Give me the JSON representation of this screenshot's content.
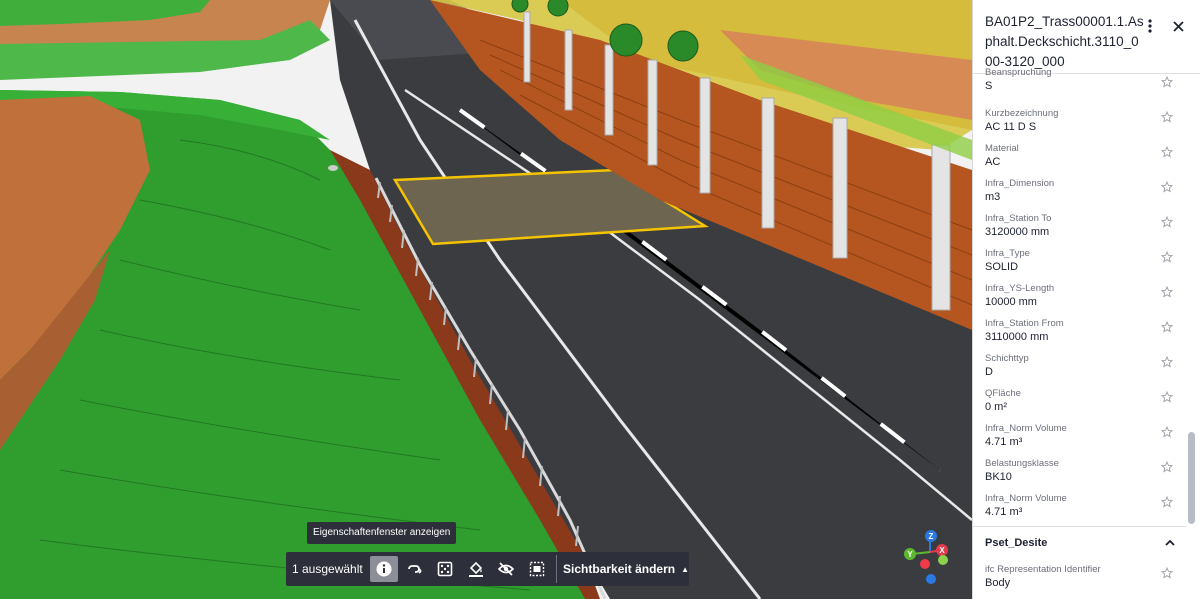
{
  "viewer": {
    "tooltip": "Eigenschaftenfenster anzeigen",
    "toolbar": {
      "selection_count": "1 ausgewählt",
      "visibility_label": "Sichtbarkeit ändern",
      "tools": [
        "info-icon",
        "link-icon",
        "dice-icon",
        "paint-bucket-icon",
        "eye-off-icon",
        "view-fit-icon"
      ]
    },
    "gizmo": {
      "z": "Z",
      "y": "Y",
      "x": "X"
    }
  },
  "panel": {
    "title": "BA01P2_Trass00001.1.Asphalt.Deckschicht.3110_000-3120_000",
    "properties": [
      {
        "name": "Beanspruchung",
        "value": "S"
      },
      {
        "name": "Kurzbezeichnung",
        "value": "AC 11 D S"
      },
      {
        "name": "Material",
        "value": "AC"
      },
      {
        "name": "Infra_Dimension",
        "value": "m3"
      },
      {
        "name": "Infra_Station To",
        "value": "3120000 mm"
      },
      {
        "name": "Infra_Type",
        "value": "SOLID"
      },
      {
        "name": "Infra_YS-Length",
        "value": "10000 mm"
      },
      {
        "name": "Infra_Station From",
        "value": "3110000 mm"
      },
      {
        "name": "Schichttyp",
        "value": "D"
      },
      {
        "name": "QFläche",
        "value": "0 m²"
      },
      {
        "name": "Infra_Norm Volume",
        "value": "4.71 m³"
      },
      {
        "name": "Belastungsklasse",
        "value": "BK10"
      },
      {
        "name": "Infra_Norm Volume",
        "value": "4.71 m³"
      }
    ],
    "pset": {
      "title": "Pset_Desite",
      "properties": [
        {
          "name": "ifc Representation Identifier",
          "value": "Body"
        }
      ]
    }
  },
  "colors": {
    "toolbar_bg": "#2d2f3a",
    "selection_outline": "#f5c400",
    "asphalt": "#3b3c40",
    "grass": "#2f9e2f",
    "soil": "#c0703a",
    "noise_wall": "#b5551f"
  }
}
